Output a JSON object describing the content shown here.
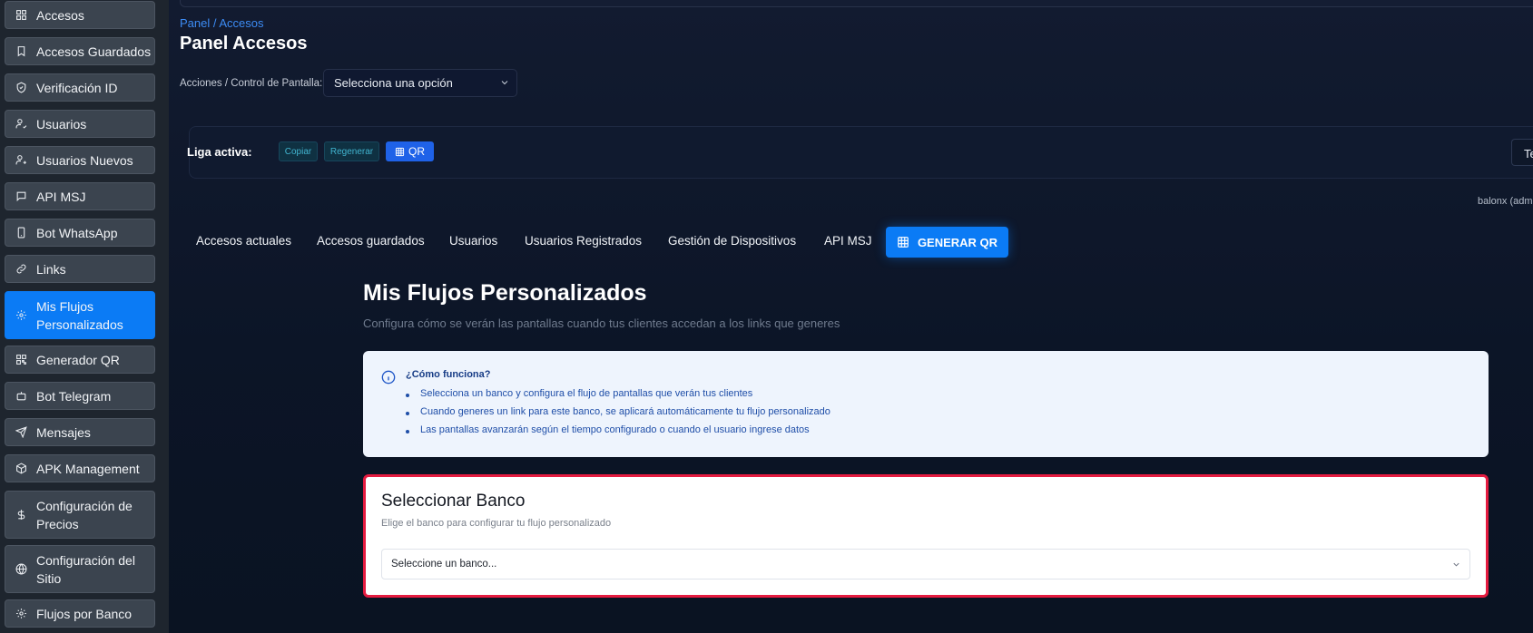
{
  "sidebar": {
    "items": [
      {
        "label": "Accesos",
        "icon": "grid-icon"
      },
      {
        "label": "Accesos Guardados",
        "icon": "bookmark-icon"
      },
      {
        "label": "Verificación ID",
        "icon": "shield-check-icon"
      },
      {
        "label": "Usuarios",
        "icon": "user-check-icon"
      },
      {
        "label": "Usuarios Nuevos",
        "icon": "user-plus-icon"
      },
      {
        "label": "API MSJ",
        "icon": "message-icon"
      },
      {
        "label": "Bot WhatsApp",
        "icon": "phone-icon"
      },
      {
        "label": "Links",
        "icon": "link-icon"
      },
      {
        "label": "Mis Flujos Personalizados",
        "icon": "gear-icon",
        "active": true
      },
      {
        "label": "Generador QR",
        "icon": "qr-icon"
      },
      {
        "label": "Bot Telegram",
        "icon": "bot-icon"
      },
      {
        "label": "Mensajes",
        "icon": "send-icon"
      },
      {
        "label": "APK Management",
        "icon": "package-icon"
      },
      {
        "label": "Configuración de Precios",
        "icon": "dollar-icon"
      },
      {
        "label": "Configuración del Sitio",
        "icon": "globe-icon"
      },
      {
        "label": "Flujos por Banco",
        "icon": "gear-icon"
      }
    ]
  },
  "header": {
    "breadcrumb": "Panel / Accesos",
    "title": "Panel Accesos",
    "control_label": "Acciones / Control de Pantalla:",
    "control_value": "Selecciona una opción"
  },
  "liga": {
    "label": "Liga activa:",
    "copy": "Copiar",
    "regen": "Regenerar",
    "qr": "QR",
    "right_btn": "Te",
    "user": "balonx (adm"
  },
  "tabs": [
    "Accesos actuales",
    "Accesos guardados",
    "Usuarios",
    "Usuarios Registrados",
    "Gestión de Dispositivos",
    "API MSJ"
  ],
  "tab_generate": "GENERAR QR",
  "flows": {
    "title": "Mis Flujos Personalizados",
    "subtitle": "Configura cómo se verán las pantallas cuando tus clientes accedan a los links que generes"
  },
  "info": {
    "title": "¿Cómo funciona?",
    "lines": [
      "Selecciona un banco y configura el flujo de pantallas que verán tus clientes",
      "Cuando generes un link para este banco, se aplicará automáticamente tu flujo personalizado",
      "Las pantallas avanzarán según el tiempo configurado o cuando el usuario ingrese datos"
    ]
  },
  "bank": {
    "title": "Seleccionar Banco",
    "subtitle": "Elige el banco para configurar tu flujo personalizado",
    "select_value": "Seleccione un banco..."
  },
  "colors": {
    "accent": "#0b7bf5",
    "sidebar_bg": "#1e252e",
    "highlight_border": "#e51b40"
  }
}
